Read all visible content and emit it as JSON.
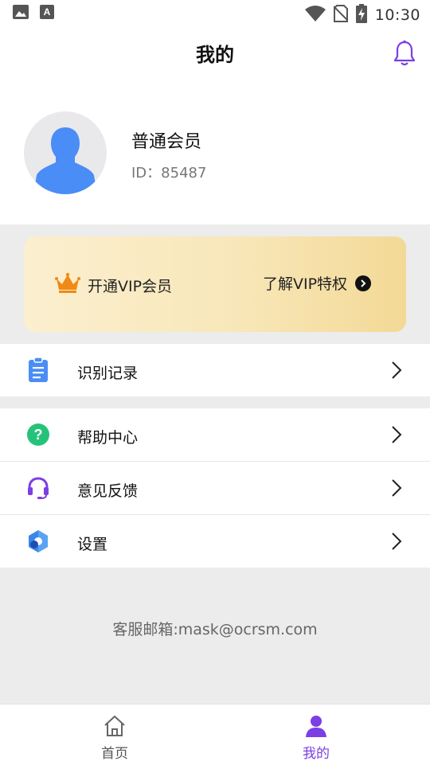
{
  "status_bar": {
    "time": "10:30",
    "left_icons": [
      "image-icon",
      "font-icon"
    ],
    "right_icons": [
      "wifi-icon",
      "no-sim-icon",
      "battery-charging-icon"
    ]
  },
  "header": {
    "title": "我的",
    "bell_icon": "bell-icon"
  },
  "profile": {
    "member_level": "普通会员",
    "user_id": "ID：85487"
  },
  "vip": {
    "open_label": "开通VIP会员",
    "learn_label": "了解VIP特权"
  },
  "menu": {
    "items": [
      {
        "label": "识别记录",
        "icon": "clipboard-icon"
      },
      {
        "label": "帮助中心",
        "icon": "help-icon"
      },
      {
        "label": "意见反馈",
        "icon": "headset-icon"
      },
      {
        "label": "设置",
        "icon": "settings-icon"
      }
    ]
  },
  "footer": {
    "contact": "客服邮箱:mask@ocrsm.com"
  },
  "bottom_nav": {
    "home": "首页",
    "mine": "我的"
  },
  "colors": {
    "accent": "#7b3fe4",
    "avatar_blue": "#4a8df6",
    "crown_orange": "#f08a16",
    "help_green": "#27c27a"
  }
}
